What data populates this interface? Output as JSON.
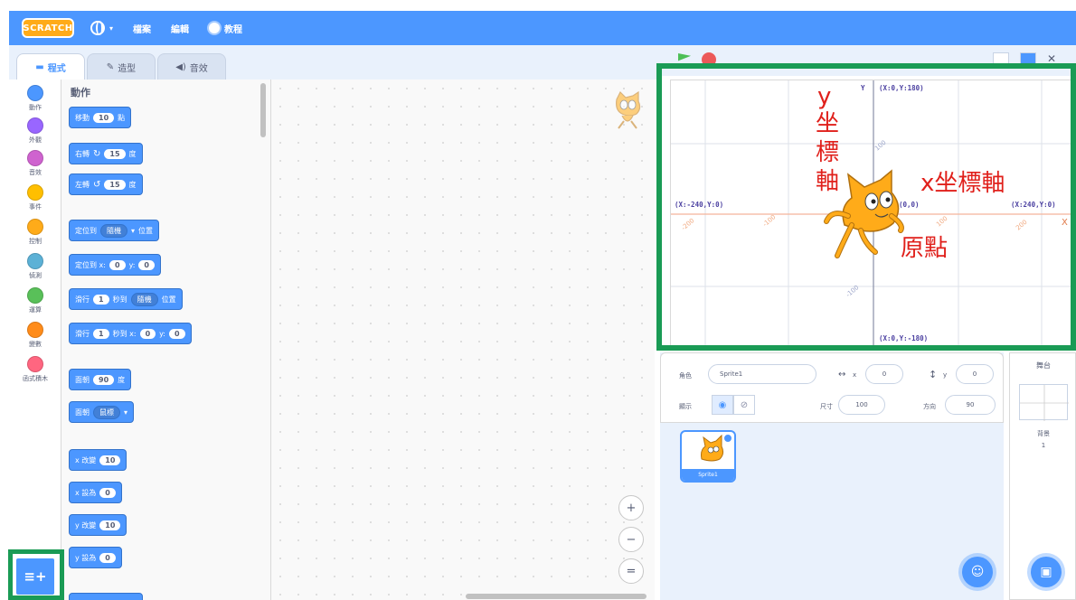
{
  "topbar": {
    "logo": "SCRATCH",
    "menu_file": "檔案",
    "menu_edit": "編輯",
    "menu_tutorials": "教程",
    "bg": "#4c97ff"
  },
  "tabs": {
    "code": "程式",
    "costumes": "造型",
    "sounds": "音效"
  },
  "categories": [
    {
      "label": "動作",
      "color": "#4c97ff"
    },
    {
      "label": "外觀",
      "color": "#9966ff"
    },
    {
      "label": "音效",
      "color": "#cf63cf"
    },
    {
      "label": "事件",
      "color": "#ffbf00"
    },
    {
      "label": "控制",
      "color": "#ffab19"
    },
    {
      "label": "偵測",
      "color": "#5cb1d6"
    },
    {
      "label": "運算",
      "color": "#59c059"
    },
    {
      "label": "變數",
      "color": "#ff8c1a"
    },
    {
      "label": "函式積木",
      "color": "#ff6680"
    }
  ],
  "palette": {
    "title": "動作",
    "b1": {
      "a": "移動",
      "v": "10",
      "b": "點"
    },
    "b2": {
      "a": "右轉",
      "v": "15",
      "b": "度"
    },
    "b3": {
      "a": "左轉",
      "v": "15",
      "b": "度"
    },
    "b4": {
      "a": "定位到",
      "d": "隨機",
      "b": "位置"
    },
    "b5": {
      "a": "定位到 x:",
      "v1": "0",
      "m": "y:",
      "v2": "0"
    },
    "b6": {
      "a": "滑行",
      "v": "1",
      "m": "秒到",
      "d": "隨機",
      "b": "位置"
    },
    "b7": {
      "a": "滑行",
      "v": "1",
      "m": "秒到 x:",
      "v1": "0",
      "m2": "y:",
      "v2": "0"
    },
    "b8": {
      "a": "面朝",
      "v": "90",
      "b": "度"
    },
    "b9": {
      "a": "面朝",
      "d": "鼠標"
    },
    "b10": {
      "a": "x 改變",
      "v": "10"
    },
    "b11": {
      "a": "x 設為",
      "v": "0"
    },
    "b12": {
      "a": "y 改變",
      "v": "10"
    },
    "b13": {
      "a": "y 設為",
      "v": "0"
    }
  },
  "zoom": {
    "in": "+",
    "out": "−",
    "reset": "="
  },
  "stage": {
    "y_axis_letter": "Y",
    "x_axis_letter": "X",
    "top_coord": "(X:0,Y:180)",
    "bottom_coord": "(X:0,Y:-180)",
    "left_coord": "(X:-240,Y:0)",
    "right_coord": "(X:240,Y:0)",
    "origin_coord": "(0,0)",
    "tick_100": "100",
    "tick_m100": "-100",
    "tick_200": "200",
    "tick_m200": "-200",
    "ann_y_letter": "y",
    "ann_y_1": "坐",
    "ann_y_2": "標",
    "ann_y_3": "軸",
    "ann_x": "x坐標軸",
    "ann_origin": "原點",
    "annotation_color": "#e0201b",
    "highlight_color": "#1a9b55"
  },
  "sprite_info": {
    "sprite_label": "角色",
    "sprite_name": "Sprite1",
    "x_label": "x",
    "x_value": "0",
    "y_label": "y",
    "y_value": "0",
    "show_label": "顯示",
    "size_label": "尺寸",
    "size_value": "100",
    "direction_label": "方向",
    "direction_value": "90"
  },
  "sprite_list": [
    {
      "name": "Sprite1"
    }
  ],
  "stage_pane": {
    "title": "舞台",
    "backdrops_label": "背景",
    "backdrops_count": "1"
  }
}
